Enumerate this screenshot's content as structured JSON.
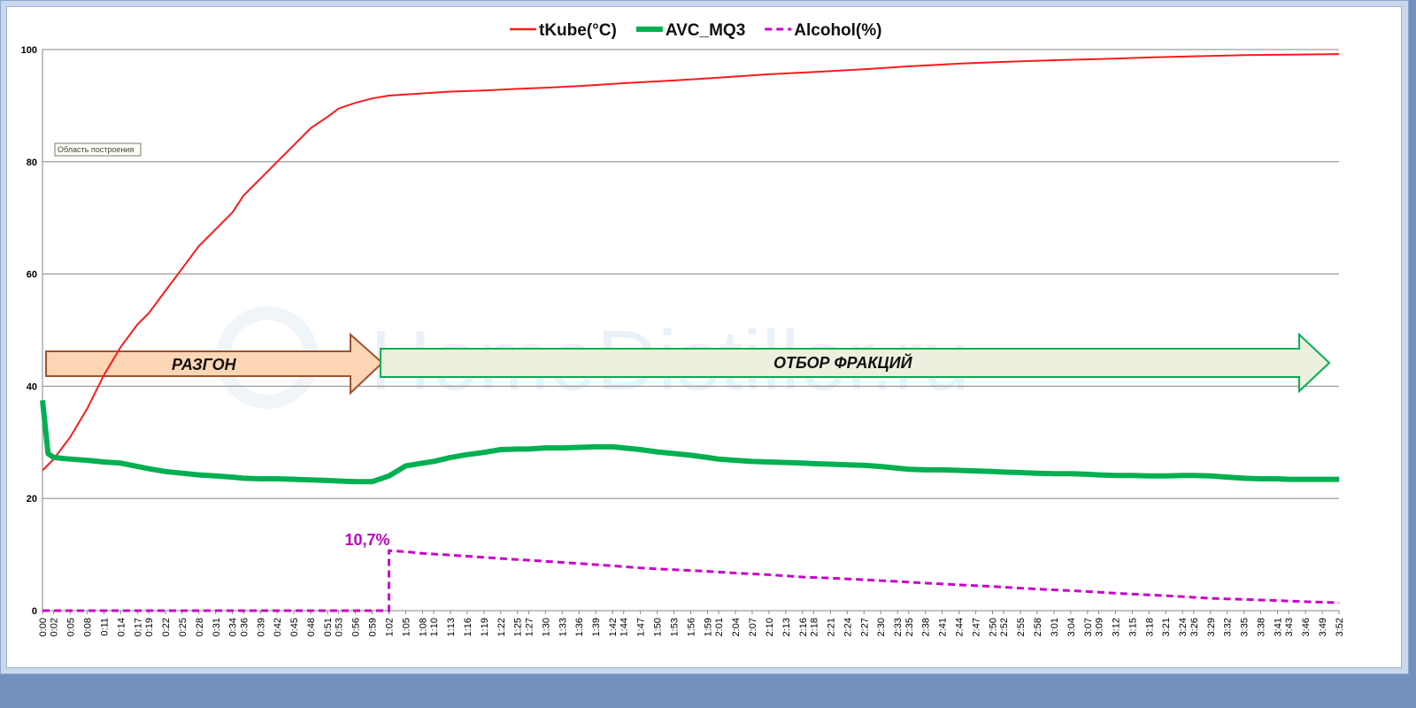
{
  "colors": {
    "tkube": "#ff1a1a",
    "avc": "#00b050",
    "alcohol": "#cc00cc",
    "arrow1_fill": "#fcd5b5",
    "arrow1_stroke": "#a0522d",
    "arrow2_fill": "#ebf1de",
    "arrow2_stroke": "#00b050"
  },
  "watermark": "HomeDistiller.ru",
  "tooltip": "Область построения",
  "annotations": {
    "arrow1": "РАЗГОН",
    "arrow2": "ОТБОР ФРАКЦИЙ",
    "peak": "10,7%"
  },
  "chart_data": {
    "type": "line",
    "legend_position": "top",
    "grid": "horizontal",
    "ylim": [
      0,
      100
    ],
    "yticks": [
      0,
      20,
      40,
      60,
      80,
      100
    ],
    "xticks": [
      "0:00",
      "0:02",
      "0:05",
      "0:08",
      "0:11",
      "0:14",
      "0:17",
      "0:19",
      "0:22",
      "0:25",
      "0:28",
      "0:31",
      "0:34",
      "0:36",
      "0:39",
      "0:42",
      "0:45",
      "0:48",
      "0:51",
      "0:53",
      "0:56",
      "0:59",
      "1:02",
      "1:05",
      "1:08",
      "1:10",
      "1:13",
      "1:16",
      "1:19",
      "1:22",
      "1:25",
      "1:27",
      "1:30",
      "1:33",
      "1:36",
      "1:39",
      "1:42",
      "1:44",
      "1:47",
      "1:50",
      "1:53",
      "1:56",
      "1:59",
      "2:01",
      "2:04",
      "2:07",
      "2:10",
      "2:13",
      "2:16",
      "2:18",
      "2:21",
      "2:24",
      "2:27",
      "2:30",
      "2:33",
      "2:35",
      "2:38",
      "2:41",
      "2:44",
      "2:47",
      "2:50",
      "2:52",
      "2:55",
      "2:58",
      "3:01",
      "3:04",
      "3:07",
      "3:09",
      "3:12",
      "3:15",
      "3:18",
      "3:21",
      "3:24",
      "3:26",
      "3:29",
      "3:32",
      "3:35",
      "3:38",
      "3:41",
      "3:43",
      "3:46",
      "3:49",
      "3:52"
    ],
    "series": [
      {
        "name": "tKube(°C)",
        "style": "solid",
        "points": [
          [
            "0:00",
            25
          ],
          [
            "0:02",
            27
          ],
          [
            "0:05",
            31
          ],
          [
            "0:08",
            36
          ],
          [
            "0:11",
            42
          ],
          [
            "0:14",
            47
          ],
          [
            "0:17",
            51
          ],
          [
            "0:19",
            53
          ],
          [
            "0:22",
            57
          ],
          [
            "0:25",
            61
          ],
          [
            "0:28",
            65
          ],
          [
            "0:31",
            68
          ],
          [
            "0:34",
            71
          ],
          [
            "0:36",
            74
          ],
          [
            "0:39",
            77
          ],
          [
            "0:42",
            80
          ],
          [
            "0:45",
            83
          ],
          [
            "0:48",
            86
          ],
          [
            "0:51",
            88
          ],
          [
            "0:53",
            89.5
          ],
          [
            "0:56",
            90.5
          ],
          [
            "0:59",
            91.3
          ],
          [
            "1:02",
            91.8
          ],
          [
            "1:05",
            92
          ],
          [
            "1:08",
            92.2
          ],
          [
            "1:13",
            92.5
          ],
          [
            "1:19",
            92.7
          ],
          [
            "1:25",
            93
          ],
          [
            "1:30",
            93.2
          ],
          [
            "1:36",
            93.5
          ],
          [
            "1:44",
            94
          ],
          [
            "1:53",
            94.5
          ],
          [
            "2:01",
            95
          ],
          [
            "2:10",
            95.6
          ],
          [
            "2:18",
            96
          ],
          [
            "2:27",
            96.5
          ],
          [
            "2:35",
            97
          ],
          [
            "2:44",
            97.5
          ],
          [
            "2:52",
            97.8
          ],
          [
            "3:01",
            98.1
          ],
          [
            "3:09",
            98.3
          ],
          [
            "3:18",
            98.6
          ],
          [
            "3:26",
            98.8
          ],
          [
            "3:35",
            99
          ],
          [
            "3:43",
            99.1
          ],
          [
            "3:52",
            99.2
          ]
        ]
      },
      {
        "name": "AVC_MQ3",
        "style": "thick",
        "points": [
          [
            "0:00",
            37.5
          ],
          [
            "0:01",
            28
          ],
          [
            "0:02",
            27.3
          ],
          [
            "0:05",
            27
          ],
          [
            "0:08",
            26.8
          ],
          [
            "0:11",
            26.5
          ],
          [
            "0:14",
            26.3
          ],
          [
            "0:17",
            25.7
          ],
          [
            "0:19",
            25.3
          ],
          [
            "0:22",
            24.8
          ],
          [
            "0:25",
            24.5
          ],
          [
            "0:28",
            24.2
          ],
          [
            "0:31",
            24
          ],
          [
            "0:34",
            23.8
          ],
          [
            "0:36",
            23.6
          ],
          [
            "0:39",
            23.5
          ],
          [
            "0:42",
            23.5
          ],
          [
            "0:45",
            23.4
          ],
          [
            "0:48",
            23.3
          ],
          [
            "0:51",
            23.2
          ],
          [
            "0:53",
            23.1
          ],
          [
            "0:56",
            23
          ],
          [
            "0:59",
            23
          ],
          [
            "1:02",
            24
          ],
          [
            "1:05",
            25.8
          ],
          [
            "1:08",
            26.3
          ],
          [
            "1:10",
            26.6
          ],
          [
            "1:13",
            27.3
          ],
          [
            "1:16",
            27.8
          ],
          [
            "1:19",
            28.2
          ],
          [
            "1:22",
            28.7
          ],
          [
            "1:25",
            28.8
          ],
          [
            "1:27",
            28.8
          ],
          [
            "1:30",
            29
          ],
          [
            "1:33",
            29
          ],
          [
            "1:36",
            29.1
          ],
          [
            "1:39",
            29.2
          ],
          [
            "1:42",
            29.2
          ],
          [
            "1:44",
            29
          ],
          [
            "1:47",
            28.7
          ],
          [
            "1:50",
            28.3
          ],
          [
            "1:53",
            28
          ],
          [
            "1:56",
            27.7
          ],
          [
            "1:59",
            27.3
          ],
          [
            "2:01",
            27
          ],
          [
            "2:04",
            26.8
          ],
          [
            "2:07",
            26.6
          ],
          [
            "2:10",
            26.5
          ],
          [
            "2:13",
            26.4
          ],
          [
            "2:16",
            26.3
          ],
          [
            "2:18",
            26.2
          ],
          [
            "2:21",
            26.1
          ],
          [
            "2:24",
            26
          ],
          [
            "2:27",
            25.9
          ],
          [
            "2:30",
            25.7
          ],
          [
            "2:33",
            25.4
          ],
          [
            "2:35",
            25.2
          ],
          [
            "2:38",
            25.1
          ],
          [
            "2:41",
            25.1
          ],
          [
            "2:44",
            25
          ],
          [
            "2:47",
            24.9
          ],
          [
            "2:50",
            24.8
          ],
          [
            "2:52",
            24.7
          ],
          [
            "2:55",
            24.6
          ],
          [
            "2:58",
            24.5
          ],
          [
            "3:01",
            24.4
          ],
          [
            "3:04",
            24.4
          ],
          [
            "3:07",
            24.3
          ],
          [
            "3:09",
            24.2
          ],
          [
            "3:12",
            24.1
          ],
          [
            "3:15",
            24.1
          ],
          [
            "3:18",
            24
          ],
          [
            "3:21",
            24
          ],
          [
            "3:24",
            24.1
          ],
          [
            "3:26",
            24.1
          ],
          [
            "3:29",
            24
          ],
          [
            "3:32",
            23.8
          ],
          [
            "3:35",
            23.6
          ],
          [
            "3:38",
            23.5
          ],
          [
            "3:41",
            23.5
          ],
          [
            "3:43",
            23.4
          ],
          [
            "3:46",
            23.4
          ],
          [
            "3:49",
            23.4
          ],
          [
            "3:52",
            23.4
          ]
        ]
      },
      {
        "name": "Alcohol(%)",
        "style": "dashed",
        "points": [
          [
            "0:00",
            0
          ],
          [
            "0:59",
            0
          ],
          [
            "1:02",
            0
          ],
          [
            "1:02",
            10.7
          ],
          [
            "1:05",
            10.5
          ],
          [
            "1:08",
            10.2
          ],
          [
            "1:13",
            9.9
          ],
          [
            "1:19",
            9.5
          ],
          [
            "1:25",
            9.1
          ],
          [
            "1:30",
            8.8
          ],
          [
            "1:36",
            8.4
          ],
          [
            "1:42",
            8.0
          ],
          [
            "1:47",
            7.6
          ],
          [
            "1:53",
            7.3
          ],
          [
            "1:59",
            7.0
          ],
          [
            "2:04",
            6.7
          ],
          [
            "2:10",
            6.4
          ],
          [
            "2:16",
            6.0
          ],
          [
            "2:21",
            5.8
          ],
          [
            "2:27",
            5.5
          ],
          [
            "2:33",
            5.2
          ],
          [
            "2:38",
            4.9
          ],
          [
            "2:44",
            4.6
          ],
          [
            "2:50",
            4.3
          ],
          [
            "2:55",
            4.0
          ],
          [
            "3:01",
            3.7
          ],
          [
            "3:07",
            3.4
          ],
          [
            "3:12",
            3.1
          ],
          [
            "3:18",
            2.8
          ],
          [
            "3:24",
            2.5
          ],
          [
            "3:29",
            2.2
          ],
          [
            "3:35",
            2.0
          ],
          [
            "3:41",
            1.8
          ],
          [
            "3:46",
            1.6
          ],
          [
            "3:52",
            1.4
          ]
        ]
      }
    ]
  }
}
